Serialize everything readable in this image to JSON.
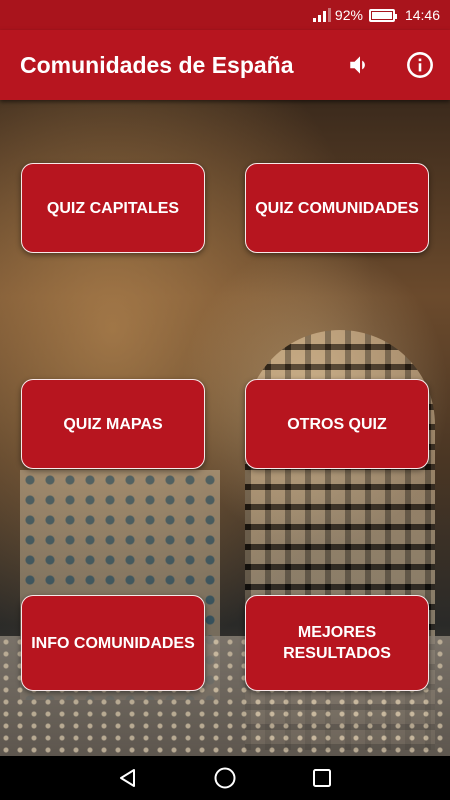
{
  "status_bar": {
    "battery_percent": "92%",
    "time": "14:46",
    "battery_level": 0.92
  },
  "app_bar": {
    "title": "Comunidades de España",
    "sound_icon": "speaker-icon",
    "info_icon": "info-icon"
  },
  "menu": {
    "buttons": [
      {
        "label": "QUIZ CAPITALES"
      },
      {
        "label": "QUIZ COMUNIDADES"
      },
      {
        "label": "QUIZ MAPAS"
      },
      {
        "label": "OTROS QUIZ"
      },
      {
        "label": "INFO COMUNIDADES"
      },
      {
        "label": "MEJORES RESULTADOS"
      }
    ]
  },
  "colors": {
    "primary": "#b7151f",
    "status_bar": "#a9141c",
    "text": "#ffffff"
  },
  "nav_bar": {
    "back_icon": "back-triangle-icon",
    "home_icon": "home-circle-icon",
    "recents_icon": "recents-square-icon"
  }
}
